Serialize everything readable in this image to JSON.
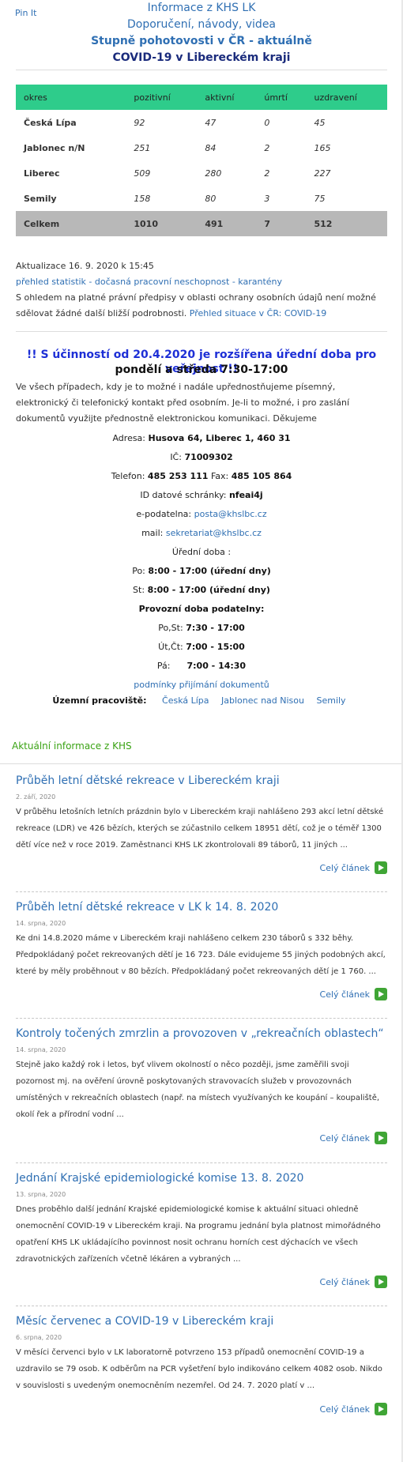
{
  "pin_label": "Pin It",
  "header": {
    "link1": "Informace z KHS LK",
    "link2": "Doporučení, návody, videa",
    "link3": "Stupně pohotovosti v ČR - aktuálně",
    "link4": "COVID-19 v Libereckém kraji"
  },
  "stats": {
    "headers": [
      "okres",
      "pozitivní",
      "aktivní",
      "úmrtí",
      "uzdravení"
    ],
    "rows": [
      [
        "Česká Lípa",
        "92",
        "47",
        "0",
        "45"
      ],
      [
        "Jablonec n/N",
        "251",
        "84",
        "2",
        "165"
      ],
      [
        "Liberec",
        "509",
        "280",
        "2",
        "227"
      ],
      [
        "Semily",
        "158",
        "80",
        "3",
        "75"
      ]
    ],
    "total": [
      "Celkem",
      "1010",
      "491",
      "7",
      "512"
    ],
    "header_color": "#2ecc8b",
    "total_color": "#b8b8b8"
  },
  "update": {
    "date": "Aktualizace 16. 9. 2020 k 15:45",
    "stats_link": "přehled statistik - dočasná pracovní neschopnost - karantény",
    "note": "S ohledem na platné právní předpisy v oblasti ochrany osobních údajů není možné sdělovat žádné další bližší podrobnosti.",
    "overview_link": "Přehled situace v ČR: COVID-19"
  },
  "notice": {
    "line1": "!! S účinností od 20.4.2020 je rozšířena úřední doba pro veřejnost  !!",
    "line2": "pondělí a středa 7:30-17:00",
    "text": "Ve všech případech, kdy je to možné i nadále upřednostňujeme písemný, elektronický či telefonický kontakt před osobním. Je-li to možné, i pro zaslání dokumentů využijte přednostně elektronickou komunikaci. Děkujeme"
  },
  "contact": {
    "address_label": "Adresa:",
    "address": "Husova 64, Liberec 1, 460 31",
    "ic_label": "IČ:",
    "ic": "71009302",
    "phone_label": "Telefon:",
    "phone": "485 253 111",
    "fax_label": "Fax:",
    "fax": "485 105 864",
    "ds_label": "ID datové schránky:",
    "ds": "nfeai4j",
    "epod_label": "e-podatelna:",
    "epod": "posta@khslbc.cz",
    "mail_label": "mail:",
    "mail": "sekretariat@khslbc.cz",
    "hours_title": "Úřední doba :",
    "po_label": "Po:",
    "po": "8:00 - 17:00 (úřední dny)",
    "st_label": "St:",
    "st": "8:00 - 17:00 (úřední dny)",
    "podatelna_title": "Provozní doba podatelny:",
    "post_st_label": "Po,St:",
    "post_st": "7:30 - 17:00",
    "ut_ct_label": "Út,Čt:",
    "ut_ct": "7:00 - 15:00",
    "pa_label": "Pá:",
    "pa": "7:00 - 14:30",
    "conditions_link": "podmínky přijímání dokumentů",
    "offices_label": "Územní pracoviště:",
    "offices": [
      "Česká Lípa",
      "Jablonec nad Nisou",
      "Semily"
    ]
  },
  "news_section_title": "Aktuální informace z KHS",
  "more_label": "Celý článek",
  "articles": [
    {
      "title": "Průběh letní dětské rekreace v Libereckém kraji",
      "date": "2. září, 2020",
      "text": "V průběhu letošních letních prázdnin bylo v Libereckém kraji nahlášeno 293 akcí letní dětské rekreace (LDR) ve 426 bězích, kterých se zúčastnilo celkem 18951 dětí, což je o téměř 1300 dětí více než v roce 2019. Zaměstnanci KHS LK zkontrolovali 89 táborů, 11 jiných ..."
    },
    {
      "title": "Průběh letní dětské rekreace v LK k 14. 8. 2020",
      "date": "14. srpna, 2020",
      "text": "Ke dni 14.8.2020 máme v Libereckém kraji nahlášeno celkem 230 táborů s 332 běhy. Předpokládaný počet rekreovaných dětí je 16 723.  Dále evidujeme 55 jiných podobných akcí, které by měly proběhnout v 80 bězích. Předpokládaný počet rekreovaných dětí je 1 760. ..."
    },
    {
      "title": "Kontroly točených zmrzlin a provozoven v „rekreačních oblastech“",
      "date": "14. srpna, 2020",
      "text": "Stejně jako každý rok i letos, byť vlivem okolností o něco později, jsme zaměřili svoji pozornost mj. na  ověření úrovně poskytovaných stravovacích služeb v provozovnách umístěných v rekreačních oblastech (např. na místech využívaných ke koupání – koupaliště, okolí řek a přírodní vodní ..."
    },
    {
      "title": "Jednání Krajské epidemiologické komise 13. 8. 2020",
      "date": "13. srpna, 2020",
      "text": "Dnes proběhlo další jednání Krajské epidemiologické komise k aktuální situaci ohledně onemocnění COVID-19 v Libereckém kraji. Na programu jednání byla platnost mimořádného opatření KHS LK ukládajícího povinnost nosit ochranu horních cest dýchacích ve všech zdravotnických zařízeních včetně lékáren a vybraných ..."
    },
    {
      "title": "Měsíc červenec a COVID-19 v Libereckém kraji",
      "date": "6. srpna, 2020",
      "text": "V měsíci červenci bylo v LK laboratorně potvrzeno 153 případů onemocnění COVID-19 a uzdravilo se 79 osob. K odběrům na PCR vyšetření  bylo indikováno celkem 4082 osob. Nikdo v souvislosti s uvedeným onemocněním nezemřel. Od 24. 7. 2020 platí v ..."
    }
  ],
  "colors": {
    "link": "#2f6fb3",
    "notice": "#1d2fd6",
    "section": "#3aa314",
    "arrow": "#3fa535"
  }
}
